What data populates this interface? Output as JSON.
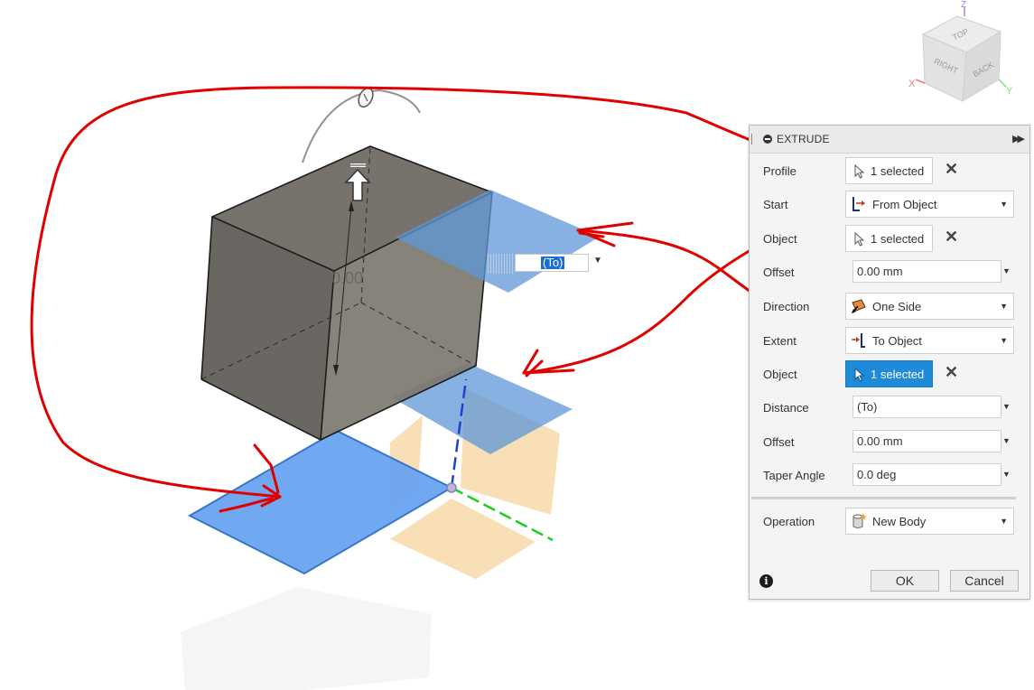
{
  "viewport": {
    "dimension_value": "30.00",
    "canvas_input_value": "(To)"
  },
  "viewcube": {
    "face_top": "TOP",
    "face_right": "RIGHT",
    "face_back": "BACK",
    "axis_x": "X",
    "axis_y": "Y",
    "axis_z": "Z"
  },
  "extrude": {
    "title": "EXTRUDE",
    "profile_label": "Profile",
    "profile_value": "1 selected",
    "start_label": "Start",
    "start_value": "From Object",
    "object_label": "Object",
    "object_value": "1 selected",
    "offset_label": "Offset",
    "offset_value": "0.00 mm",
    "direction_label": "Direction",
    "direction_value": "One Side",
    "extent_label": "Extent",
    "extent_value": "To Object",
    "object2_label": "Object",
    "object2_value": "1 selected",
    "distance_label": "Distance",
    "distance_value": "(To)",
    "offset2_label": "Offset",
    "offset2_value": "0.00 mm",
    "taper_label": "Taper Angle",
    "taper_value": "0.0 deg",
    "operation_label": "Operation",
    "operation_value": "New Body",
    "info_icon": "i",
    "ok_label": "OK",
    "cancel_label": "Cancel"
  },
  "colors": {
    "annotation": "#e00000",
    "selected_blue": "#1f8bd8",
    "plane_blue": "#5d95d6",
    "origin_plane": "#f5d29c",
    "body_gray": "#6d6a65"
  }
}
